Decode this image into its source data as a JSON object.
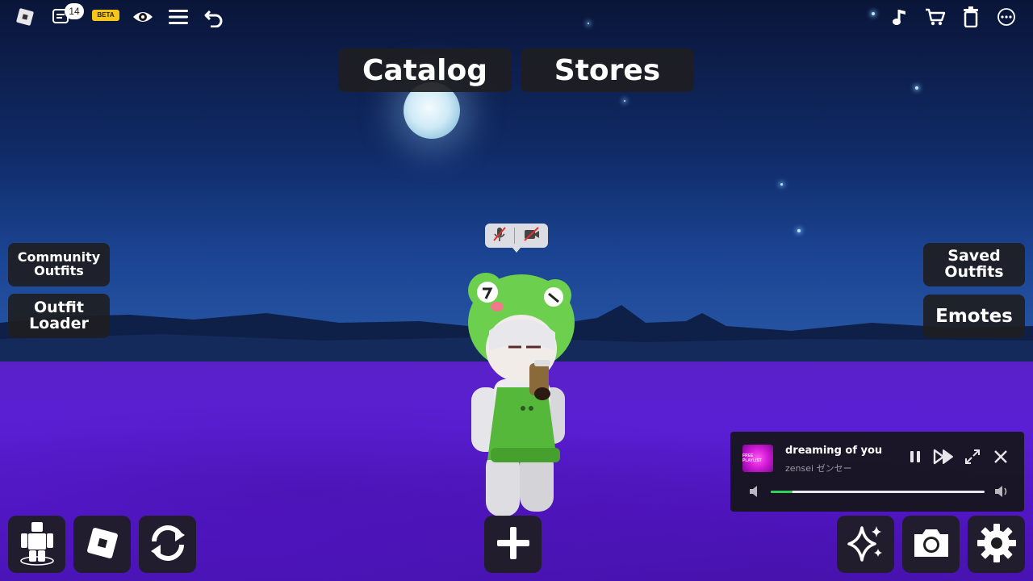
{
  "topbar": {
    "icons": [
      "roblox-logo-icon",
      "chat-icon",
      "beta-badge",
      "eye-icon",
      "menu-icon",
      "undo-icon",
      "music-note-icon",
      "cart-icon",
      "trash-icon",
      "more-icon"
    ],
    "chat_count": "14",
    "beta_label": "BETA"
  },
  "tabs": {
    "catalog": "Catalog",
    "stores": "Stores"
  },
  "left_panel": {
    "community_outfits": [
      "Community",
      "Outfits"
    ],
    "outfit_loader": [
      "Outfit",
      "Loader"
    ]
  },
  "right_panel": {
    "saved_outfits": [
      "Saved",
      "Outfits"
    ],
    "emotes": "Emotes"
  },
  "voice_chat": {
    "icons": [
      "mic-muted-icon",
      "camera-off-icon"
    ]
  },
  "bottom_left": {
    "icons": [
      "avatar-editor-icon",
      "roblox-icon",
      "refresh-icon"
    ]
  },
  "bottom_center": {
    "icon": "plus-icon"
  },
  "bottom_right": {
    "icons": [
      "sparkles-icon",
      "camera-icon",
      "settings-gear-icon"
    ]
  },
  "player": {
    "title": "dreaming of you",
    "artist": "zensei ゼンセー",
    "album_art_text": "FREE PLAYLIST",
    "progress": 0.1,
    "accent_color": "#2fd35a",
    "controls": [
      "pause-icon",
      "skip-forward-icon",
      "expand-icon",
      "close-icon"
    ]
  }
}
